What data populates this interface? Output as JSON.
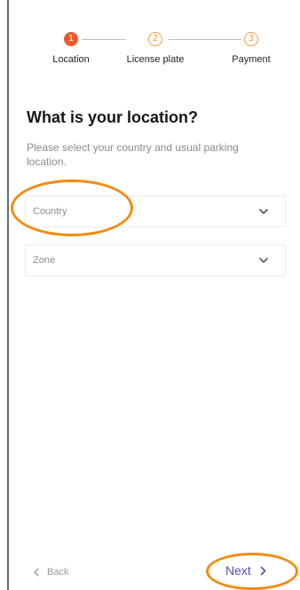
{
  "stepper": {
    "steps": [
      {
        "number": "1",
        "label": "Location"
      },
      {
        "number": "2",
        "label": "License plate"
      },
      {
        "number": "3",
        "label": "Payment"
      }
    ]
  },
  "main": {
    "title": "What is your location?",
    "subtitle": "Please select your country and usual parking location."
  },
  "fields": {
    "country": {
      "value": "Country"
    },
    "zone": {
      "value": "Zone"
    }
  },
  "footer": {
    "back_label": "Back",
    "next_label": "Next"
  },
  "colors": {
    "accent_orange": "#f0582a",
    "highlight": "#f28b12",
    "next_purple": "#5a4ab0"
  }
}
